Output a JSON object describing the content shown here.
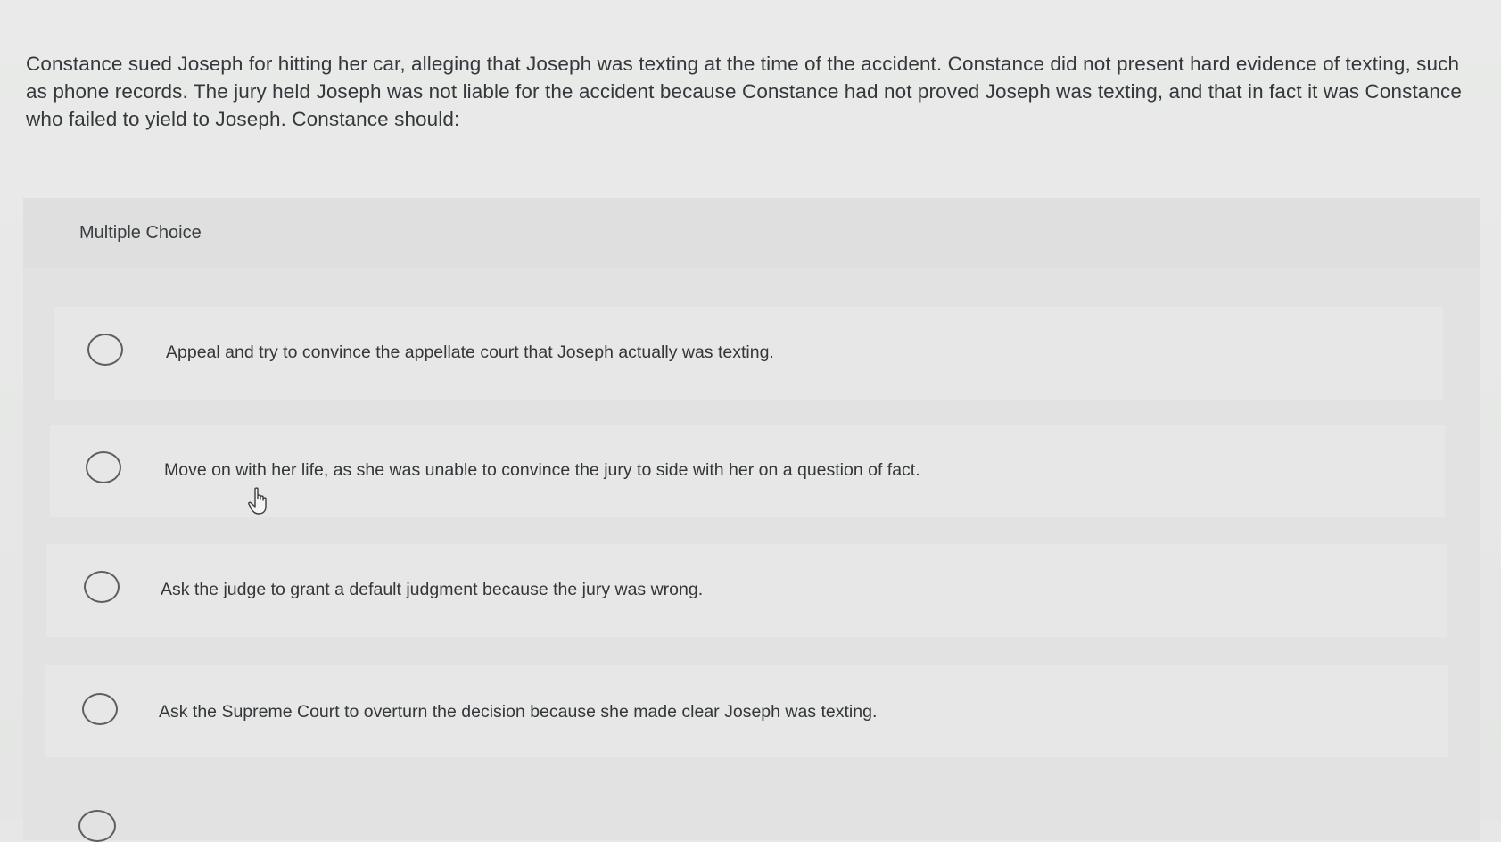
{
  "question": {
    "text": "Constance sued Joseph for hitting her car, alleging that Joseph was texting at the time of the accident. Constance did not present hard evidence of texting, such as phone records. The jury held Joseph was not liable for the accident because Constance had not proved Joseph was texting, and that in fact it was Constance who failed to yield to Joseph. Constance should:"
  },
  "panel": {
    "label": "Multiple Choice"
  },
  "options": [
    {
      "text": "Appeal and try to convince the appellate court that Joseph actually was texting."
    },
    {
      "text": "Move on with her life, as she was unable to convince the jury to side with her on a question of fact."
    },
    {
      "text": "Ask the judge to grant a default judgment because the jury was wrong."
    },
    {
      "text": "Ask the Supreme Court to overturn the decision because she made clear Joseph was texting."
    }
  ],
  "icons": {
    "cursor": "hand-pointer-icon",
    "radio": "radio-unselected-icon"
  }
}
